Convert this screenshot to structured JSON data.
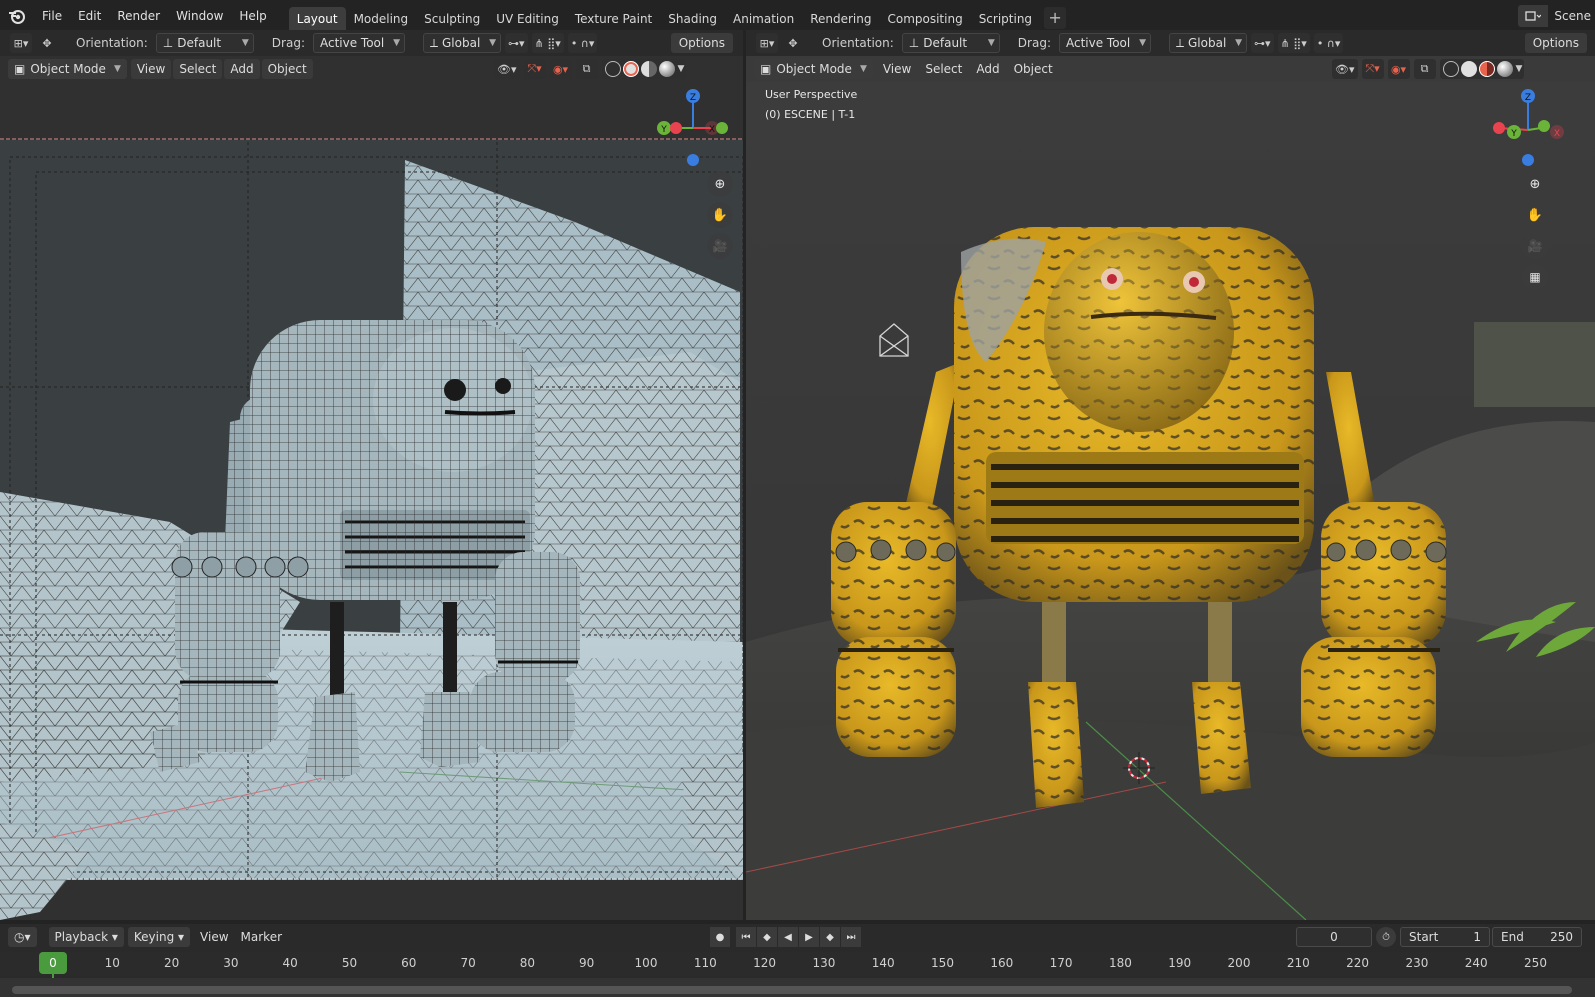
{
  "topbar": {
    "menu": [
      "File",
      "Edit",
      "Render",
      "Window",
      "Help"
    ],
    "workspaces": [
      "Layout",
      "Modeling",
      "Sculpting",
      "UV Editing",
      "Texture Paint",
      "Shading",
      "Animation",
      "Rendering",
      "Compositing",
      "Scripting"
    ],
    "active_workspace": "Layout",
    "add_tab": "+",
    "scene_label": "Scene"
  },
  "viewport_header": {
    "orientation_label": "Orientation:",
    "orientation_value": "Default",
    "drag_label": "Drag:",
    "drag_value": "Active Tool",
    "transform_space": "Global",
    "options_label": "Options",
    "mode": "Object Mode",
    "menus": [
      "View",
      "Select",
      "Add",
      "Object"
    ]
  },
  "right_viewport": {
    "overlay_line1": "User Perspective",
    "overlay_line2": "(0) ESCENE | T-1"
  },
  "gizmo": {
    "z": "Z",
    "y": "Y",
    "x": "X"
  },
  "timeline": {
    "playback": "Playback",
    "keying": "Keying",
    "view": "View",
    "marker": "Marker",
    "current_frame": "0",
    "start_label": "Start",
    "start_value": "1",
    "end_label": "End",
    "end_value": "250",
    "ticks": [
      "10",
      "20",
      "30",
      "40",
      "50",
      "60",
      "70",
      "80",
      "90",
      "100",
      "110",
      "120",
      "130",
      "140",
      "150",
      "160",
      "170",
      "180",
      "190",
      "200",
      "210",
      "220",
      "230",
      "240",
      "250"
    ],
    "playhead_frame": "0"
  },
  "colors": {
    "active_tab": "#3d3d3d",
    "playhead": "#4a9b3d",
    "axis_x": "#e8434e",
    "axis_y": "#6ab43a",
    "axis_z": "#3a7de0",
    "robot_yellow": "#d9a920"
  }
}
